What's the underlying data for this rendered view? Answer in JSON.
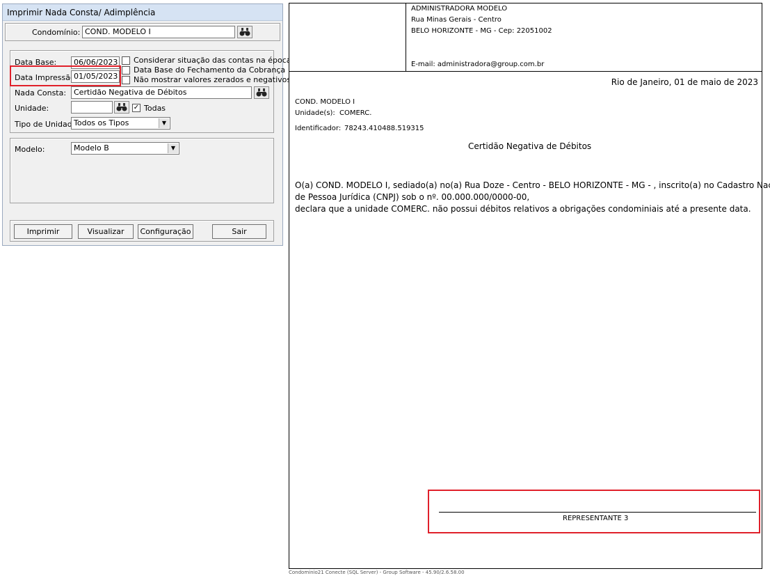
{
  "dialog": {
    "title": "Imprimir Nada Consta/ Adimplência",
    "condominio_label": "Condomínio:",
    "condominio_value": "COND. MODELO I",
    "data_base_label": "Data Base:",
    "data_base_value": "06/06/2023",
    "data_impressao_label": "Data Impressão:",
    "data_impressao_value": "01/05/2023",
    "checks": [
      {
        "label": "Considerar situação das contas na época",
        "checked": false
      },
      {
        "label": "Data Base do Fechamento da Cobrança",
        "checked": false
      },
      {
        "label": "Não mostrar valores zerados e negativos",
        "checked": false
      }
    ],
    "nada_consta_label": "Nada Consta:",
    "nada_consta_value": "Certidão Negativa de Débitos",
    "unidade_label": "Unidade:",
    "unidade_value": "",
    "todas_label": "Todas",
    "todas_mark": "✓",
    "tipo_unidade_label": "Tipo de Unidade:",
    "tipo_unidade_value": "Todos os Tipos",
    "modelo_label": "Modelo:",
    "modelo_value": "Modelo B",
    "buttons": {
      "imprimir": "Imprimir",
      "visualizar": "Visualizar",
      "configuracao": "Configuração",
      "sair": "Sair"
    }
  },
  "preview": {
    "header": {
      "company": "ADMINISTRADORA MODELO",
      "street": "Rua Minas Gerais - Centro",
      "city": "BELO HORIZONTE - MG - Cep: 22051002",
      "email": "E-mail: administradora@group.com.br"
    },
    "date_line": "Rio de Janeiro, 01 de maio de 2023",
    "cond_name": "COND. MODELO I",
    "unidade_label": "Unidade(s):",
    "unidade_value": "COMERC.",
    "identificador_label": "Identificador:",
    "identificador_value": "78243.410488.519315",
    "doc_title": "Certidão Negativa de Débitos",
    "body_line1": "O(a) COND. MODELO I, sediado(a) no(a) Rua Doze - Centro - BELO HORIZONTE - MG - , inscrito(a) no Cadastro Nacional",
    "body_line2": "de Pessoa Jurídica (CNPJ) sob o nº. 00.000.000/0000-00,",
    "body_line3": "declara que a unidade COMERC. não possui débitos relativos a obrigações condominiais até a presente data.",
    "signature": "REPRESENTANTE 3",
    "footer": "Condominio21 Conecte  (SQL Server)  - Group Software - 45.90/2.6.58.00"
  },
  "colors": {
    "highlight": "#e0202a",
    "titlebar": "#d6e3f3"
  }
}
